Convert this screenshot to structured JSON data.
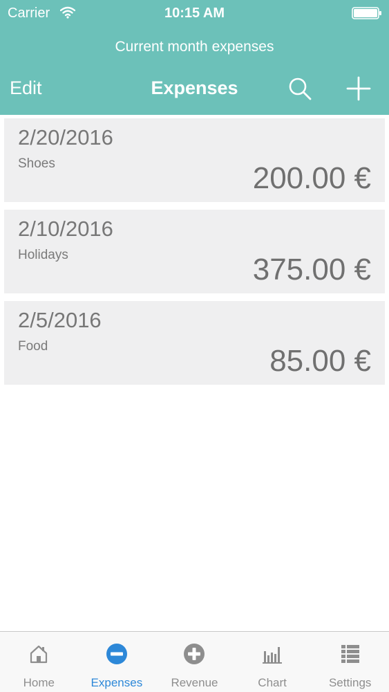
{
  "status_bar": {
    "carrier": "Carrier",
    "time": "10:15 AM"
  },
  "header": {
    "subtitle": "Current month expenses",
    "edit_label": "Edit",
    "title": "Expenses",
    "search_icon": "search-icon",
    "add_icon": "plus-icon",
    "background_color": "#6cc1b9"
  },
  "expenses": [
    {
      "date": "2/20/2016",
      "category": "Shoes",
      "amount": "200.00 €"
    },
    {
      "date": "2/10/2016",
      "category": "Holidays",
      "amount": "375.00 €"
    },
    {
      "date": "2/5/2016",
      "category": "Food",
      "amount": "85.00 €"
    }
  ],
  "tabs": [
    {
      "label": "Home",
      "icon": "home-icon",
      "active": false
    },
    {
      "label": "Expenses",
      "icon": "minus-circle-icon",
      "active": true
    },
    {
      "label": "Revenue",
      "icon": "plus-circle-icon",
      "active": false
    },
    {
      "label": "Chart",
      "icon": "bar-chart-icon",
      "active": false
    },
    {
      "label": "Settings",
      "icon": "list-icon",
      "active": false
    }
  ],
  "colors": {
    "accent": "#2d88d8",
    "inactive": "#8e8e8e",
    "row_background": "#efeff0"
  }
}
